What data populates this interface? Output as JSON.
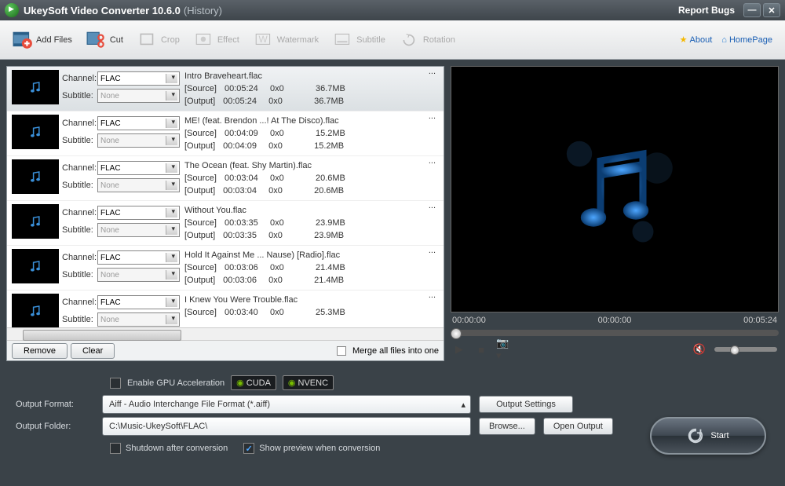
{
  "title": {
    "main": "UkeySoft Video Converter 10.6.0",
    "sub": "(History)"
  },
  "report_bugs": "Report Bugs",
  "toolbar": {
    "add_files": "Add Files",
    "cut": "Cut",
    "crop": "Crop",
    "effect": "Effect",
    "watermark": "Watermark",
    "subtitle": "Subtitle",
    "rotation": "Rotation",
    "about": "About",
    "homepage": "HomePage"
  },
  "labels": {
    "channel": "Channel:",
    "subtitle": "Subtitle:",
    "source": "[Source]",
    "output": "[Output]"
  },
  "channel_value": "FLAC",
  "subtitle_value": "None",
  "files": [
    {
      "name": "Intro Braveheart.flac",
      "src_time": "00:05:24",
      "src_res": "0x0",
      "src_size": "36.7MB",
      "out_time": "00:05:24",
      "out_res": "0x0",
      "out_size": "36.7MB"
    },
    {
      "name": "ME! (feat. Brendon ...! At The Disco).flac",
      "src_time": "00:04:09",
      "src_res": "0x0",
      "src_size": "15.2MB",
      "out_time": "00:04:09",
      "out_res": "0x0",
      "out_size": "15.2MB"
    },
    {
      "name": "The Ocean (feat. Shy Martin).flac",
      "src_time": "00:03:04",
      "src_res": "0x0",
      "src_size": "20.6MB",
      "out_time": "00:03:04",
      "out_res": "0x0",
      "out_size": "20.6MB"
    },
    {
      "name": "Without You.flac",
      "src_time": "00:03:35",
      "src_res": "0x0",
      "src_size": "23.9MB",
      "out_time": "00:03:35",
      "out_res": "0x0",
      "out_size": "23.9MB"
    },
    {
      "name": "Hold It Against Me ... Nause) [Radio].flac",
      "src_time": "00:03:06",
      "src_res": "0x0",
      "src_size": "21.4MB",
      "out_time": "00:03:06",
      "out_res": "0x0",
      "out_size": "21.4MB"
    },
    {
      "name": "I Knew You Were Trouble.flac",
      "src_time": "00:03:40",
      "src_res": "0x0",
      "src_size": "25.3MB",
      "out_time": "",
      "out_res": "",
      "out_size": ""
    }
  ],
  "bottom": {
    "remove": "Remove",
    "clear": "Clear",
    "merge": "Merge all files into one"
  },
  "preview": {
    "t1": "00:00:00",
    "t2": "00:00:00",
    "t3": "00:05:24"
  },
  "gpu": {
    "enable": "Enable GPU Acceleration",
    "cuda": "CUDA",
    "nvenc": "NVENC"
  },
  "output": {
    "format_label": "Output Format:",
    "format": "Aiff - Audio Interchange File Format (*.aiff)",
    "settings": "Output Settings",
    "folder_label": "Output Folder:",
    "folder": "C:\\Music-UkeySoft\\FLAC\\",
    "browse": "Browse...",
    "open": "Open Output",
    "shutdown": "Shutdown after conversion",
    "show_preview": "Show preview when conversion"
  },
  "start": "Start",
  "ellipsis": "..."
}
